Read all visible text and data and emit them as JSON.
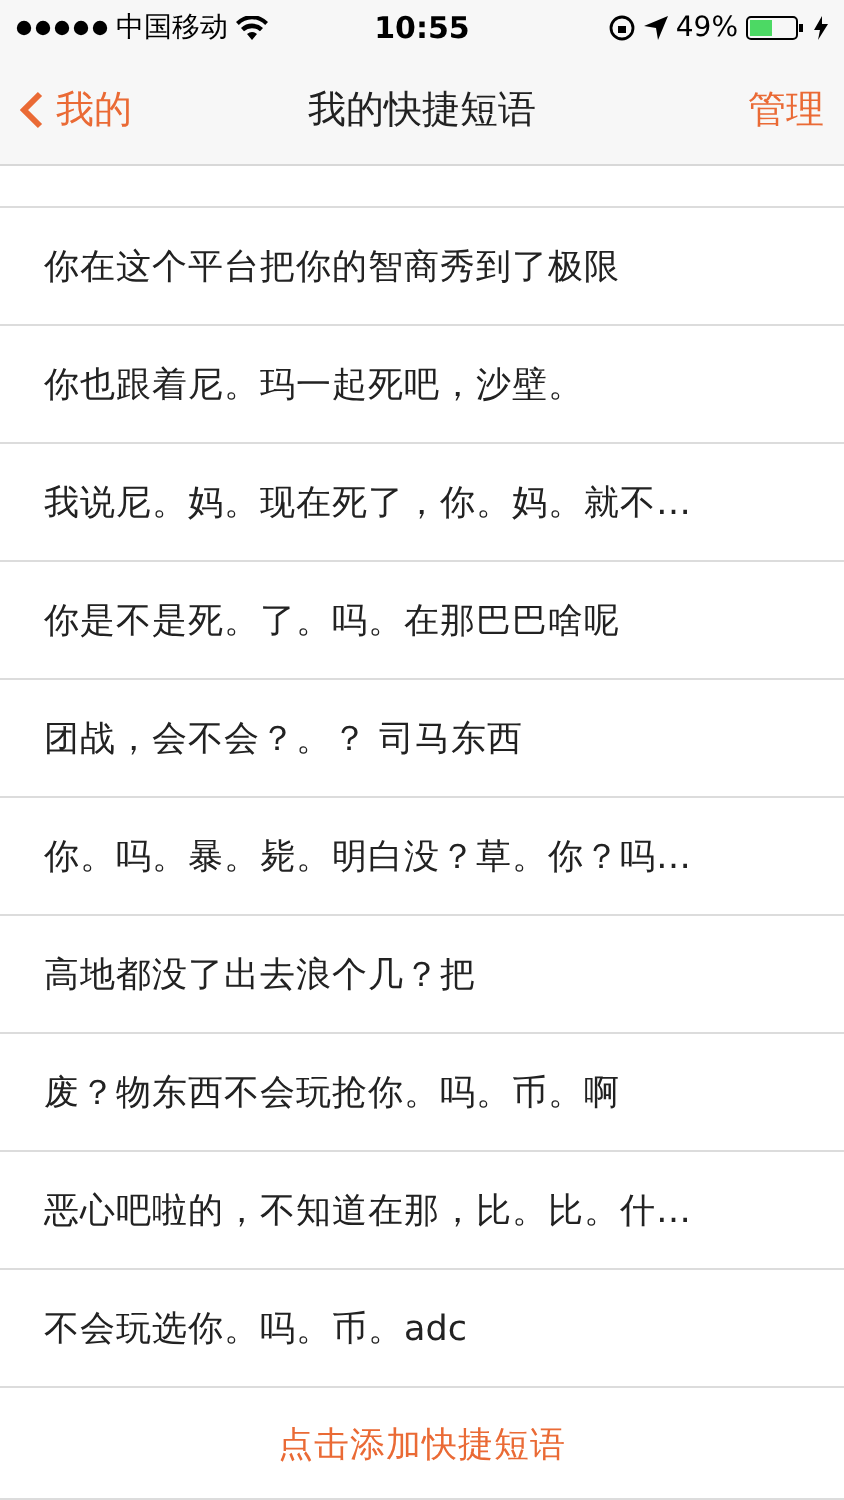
{
  "status_bar": {
    "carrier": "中国移动",
    "time": "10:55",
    "battery": "49%"
  },
  "nav": {
    "back": "我的",
    "title": "我的快捷短语",
    "action": "管理"
  },
  "phrases": [
    "你在这个平台把你的智商秀到了极限",
    "你也跟着尼。玛一起死吧，沙壁。",
    "我说尼。妈。现在死了，你。妈。就不…",
    "你是不是死。了。吗。在那巴巴啥呢",
    "团战，会不会？。？ 司马东西",
    "你。吗。暴。毙。明白没？草。你？吗…",
    "高地都没了出去浪个几？把",
    "废？物东西不会玩抢你。吗。币。啊",
    "恶心吧啦的，不知道在那，比。比。什…",
    "不会玩选你。吗。币。adc"
  ],
  "add_button": "点击添加快捷短语"
}
